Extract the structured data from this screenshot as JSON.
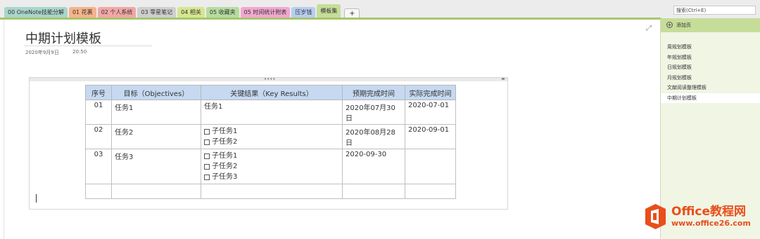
{
  "tabs": [
    {
      "label": "00 OneNote技能分解",
      "color": "#a9d5cc"
    },
    {
      "label": "01 花裹",
      "color": "#f6b38a"
    },
    {
      "label": "02 个人系统",
      "color": "#f2a6a6"
    },
    {
      "label": "03 零星笔记",
      "color": "#cfcfcf"
    },
    {
      "label": "04 相关",
      "color": "#d6e68f"
    },
    {
      "label": "05 收藏夹",
      "color": "#b5dca0"
    },
    {
      "label": "05 时间统计附表",
      "color": "#f2a7cf"
    },
    {
      "label": "压岁钱",
      "color": "#b7cdf0"
    },
    {
      "label": "模板集",
      "color": "#c6dd9a",
      "active": true
    }
  ],
  "add_tab": "+",
  "search": {
    "placeholder": "搜索(Ctrl+E)"
  },
  "note": {
    "title": "中期计划模板",
    "date": "2020年9月9日",
    "time": "20:50"
  },
  "table": {
    "headers": [
      "序号",
      "目标（Objectives）",
      "关键结果（Key Results）",
      "预期完成时间",
      "实际完成时间"
    ],
    "rows": [
      {
        "no": "01",
        "goal": "任务1",
        "results": [
          "任务1"
        ],
        "results_checkbox": false,
        "expected": "2020年07月30日",
        "actual": "2020-07-01"
      },
      {
        "no": "02",
        "goal": "任务2",
        "results": [
          "子任务1",
          "子任务2"
        ],
        "results_checkbox": true,
        "expected": "2020年08月28日",
        "actual": "2020-09-01"
      },
      {
        "no": "03",
        "goal": "任务3",
        "results": [
          "子任务1",
          "子任务2",
          "子任务3"
        ],
        "results_checkbox": true,
        "expected": "2020-09-30",
        "actual": ""
      },
      {
        "no": "",
        "goal": "",
        "results": [
          ""
        ],
        "results_checkbox": false,
        "expected": "",
        "actual": ""
      }
    ]
  },
  "sidebar": {
    "add_page": "添加页",
    "pages": [
      "周规划模板",
      "年规划模板",
      "日规划模板",
      "月规划模板",
      "文献阅读整理模板",
      "中期计划模板"
    ],
    "selected_index": 5
  },
  "brand": {
    "line1": "Office教程网",
    "line2": "www.office26.com",
    "color": "#e94e1b"
  },
  "icons": {
    "expand": "expand-icon",
    "plus": "plus-circle-icon",
    "checkbox": "checkbox-icon",
    "logo": "office-logo-icon"
  }
}
